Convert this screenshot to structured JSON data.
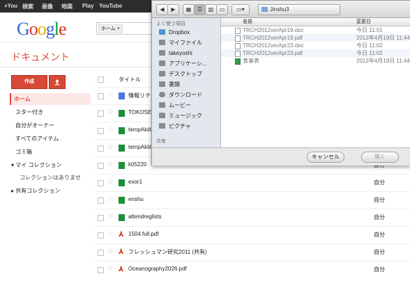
{
  "topbar": {
    "items": [
      "+You",
      "検索",
      "画像",
      "地図",
      "Play",
      "YouTube"
    ]
  },
  "logo": {
    "letters": [
      "G",
      "o",
      "o",
      "g",
      "l",
      "e"
    ]
  },
  "search": {
    "chip": "ホーム ×"
  },
  "app": {
    "title": "ドキュメント",
    "create_label": "作成"
  },
  "nav": [
    "ホーム",
    "スター付き",
    "自分がオーナー",
    "すべてのアイテム",
    "ゴミ箱",
    "▾ マイ コレクション",
    "コレクションはありませ",
    "▸ 共有コレクション"
  ],
  "list": {
    "col_title": "タイトル",
    "rows": [
      {
        "type": "doc",
        "title": "情報リテ",
        "owner": ""
      },
      {
        "type": "sheet",
        "title": "TOKOSE",
        "owner": ""
      },
      {
        "type": "sheet",
        "title": "tempAkiit",
        "owner": ""
      },
      {
        "type": "sheet",
        "title": "tempAkiit",
        "owner": ""
      },
      {
        "type": "sheet",
        "title": "k05220",
        "owner": "自分"
      },
      {
        "type": "sheet",
        "title": "exor1",
        "owner": "自分"
      },
      {
        "type": "sheet",
        "title": "enshu",
        "owner": "自分"
      },
      {
        "type": "sheet",
        "title": "attendreglists",
        "owner": "自分"
      },
      {
        "type": "pdf",
        "title": "1504.full.pdf",
        "owner": "自分"
      },
      {
        "type": "pdf",
        "title": "フレッシュマン研究2011 (共有)",
        "owner": "自分"
      },
      {
        "type": "pdf",
        "title": "Oceanography2026.pdf",
        "owner": "自分"
      }
    ]
  },
  "dialog": {
    "folder": "Jinshu3",
    "sidebar_header": "よく使う項目",
    "sidebar_items": [
      "Dropbox",
      "マイファイル",
      "takeyoshi",
      "アプリケーシ...",
      "デスクトップ",
      "書類",
      "ダウンロード",
      "ムービー",
      "ミュージック",
      "ピクチャ"
    ],
    "sidebar_footer": "共有",
    "col_name": "名前",
    "col_date": "変更日",
    "files": [
      {
        "name": "TRCH2012verApr19.doc",
        "date": "今日 11:01"
      },
      {
        "name": "TRCH2012verApr19.pdf",
        "date": "2012年4月19日 11:44"
      },
      {
        "name": "TRCH2012verApr23.doc",
        "date": "今日 11:02"
      },
      {
        "name": "TRCH2012verApr23.pdf",
        "date": "今日 11:02"
      },
      {
        "name": "食事表",
        "date": "2012年4月19日 11:44"
      }
    ],
    "cancel_label": "キャンセル",
    "open_label": "開く"
  }
}
